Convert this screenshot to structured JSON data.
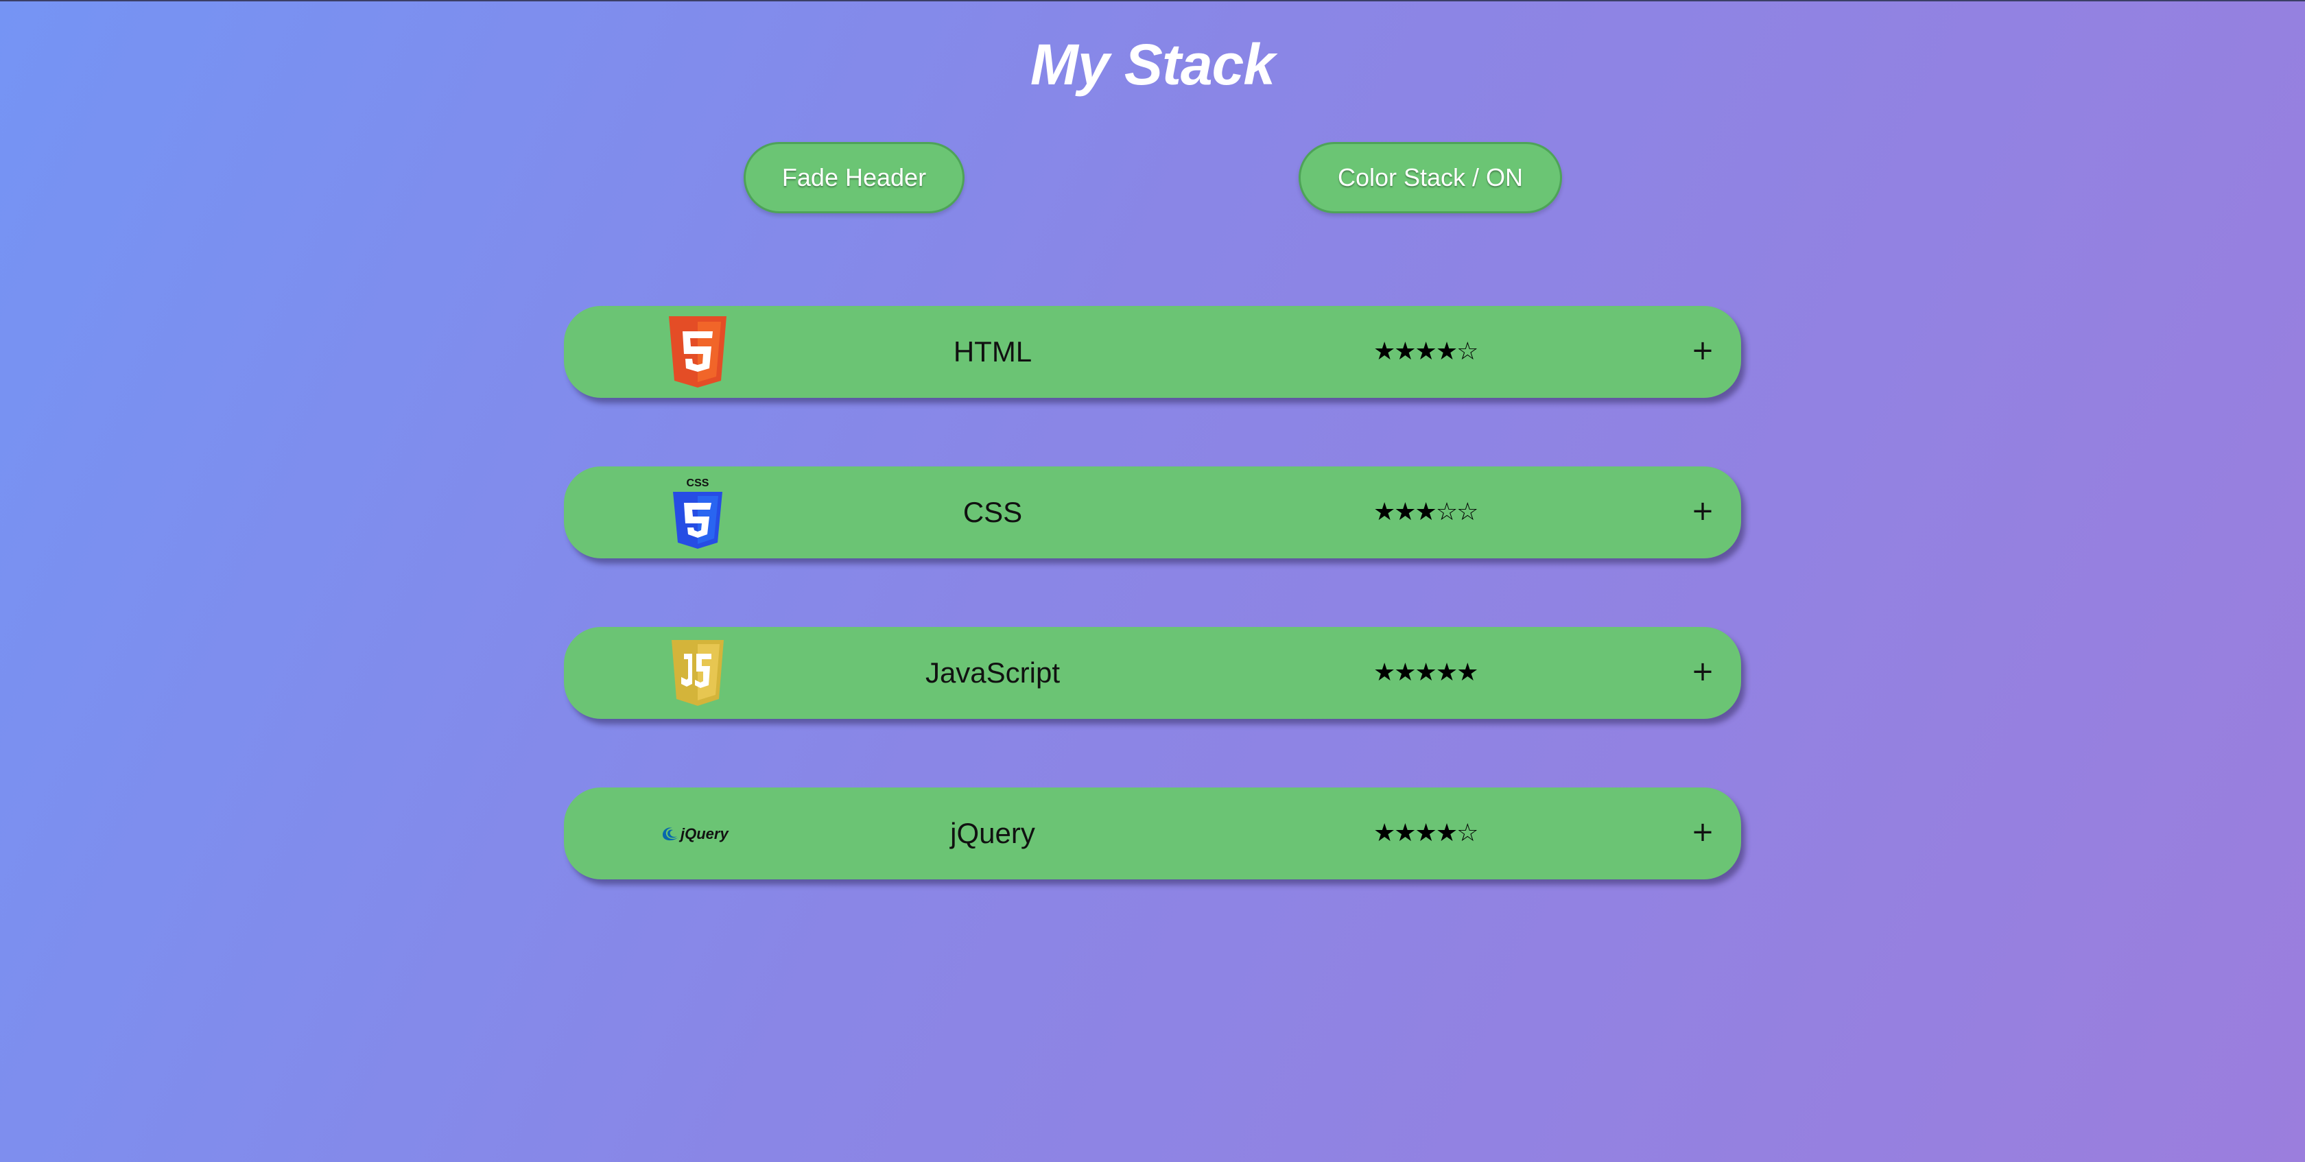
{
  "header": {
    "title": "My Stack"
  },
  "controls": {
    "fade_label": "Fade Header",
    "color_label": "Color Stack / ON"
  },
  "stack": [
    {
      "name": "HTML",
      "logo": "html5-icon",
      "rating": 4,
      "max": 5,
      "stars": "★★★★☆",
      "expand": "+"
    },
    {
      "name": "CSS",
      "logo": "css3-icon",
      "rating": 3,
      "max": 5,
      "stars": "★★★☆☆",
      "expand": "+",
      "logo_text": "CSS"
    },
    {
      "name": "JavaScript",
      "logo": "javascript-icon",
      "rating": 5,
      "max": 5,
      "stars": "★★★★★",
      "expand": "+"
    },
    {
      "name": "jQuery",
      "logo": "jquery-icon",
      "rating": 4,
      "max": 5,
      "stars": "★★★★☆",
      "expand": "+",
      "logo_text": "jQuery"
    }
  ],
  "colors": {
    "row_green": "#6bc474",
    "html_orange": "#e44d26",
    "css_blue": "#264de4",
    "js_yellow": "#e5c146"
  }
}
